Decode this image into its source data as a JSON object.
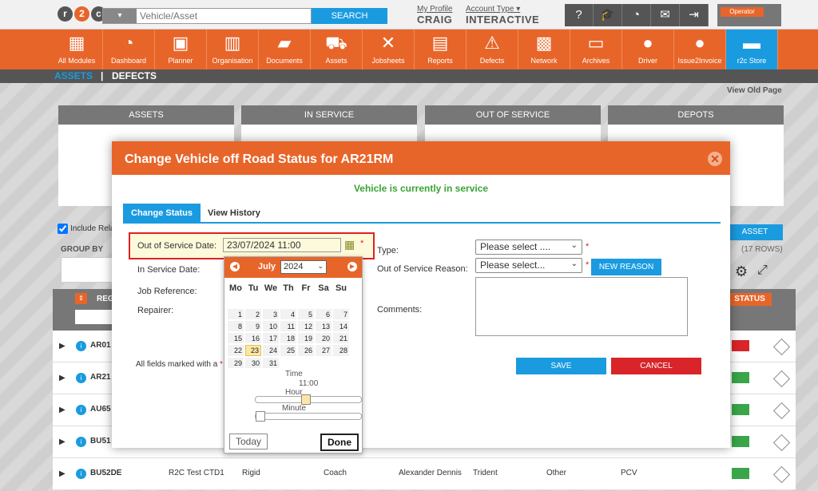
{
  "topbar": {
    "search_type_icon": "truck-icon",
    "search_placeholder": "Vehicle/Asset",
    "search_button": "SEARCH",
    "my_profile": "My Profile",
    "user_name": "CRAIG",
    "account_type_label": "Account Type",
    "account_type_value": "INTERACTIVE",
    "operator_label": "Operator"
  },
  "nav": {
    "items": [
      {
        "label": "All Modules",
        "icon": "grid-icon"
      },
      {
        "label": "Dashboard",
        "icon": "gauge-icon"
      },
      {
        "label": "Planner",
        "icon": "calendar-icon"
      },
      {
        "label": "Organisation",
        "icon": "building-icon"
      },
      {
        "label": "Documents",
        "icon": "folder-icon"
      },
      {
        "label": "Assets",
        "icon": "truck-icon"
      },
      {
        "label": "Jobsheets",
        "icon": "tools-icon"
      },
      {
        "label": "Reports",
        "icon": "clipboard-icon"
      },
      {
        "label": "Defects",
        "icon": "warning-icon"
      },
      {
        "label": "Network",
        "icon": "contact-icon"
      },
      {
        "label": "Archives",
        "icon": "archive-icon"
      },
      {
        "label": "Driver",
        "icon": "driver-icon"
      },
      {
        "label": "Issue2Invoice",
        "icon": "i2i-icon"
      },
      {
        "label": "r2c Store",
        "icon": "briefcase-icon"
      }
    ]
  },
  "subnav": {
    "assets": "ASSETS",
    "sep": "|",
    "defects": "DEFECTS"
  },
  "page": {
    "view_old": "View Old Page",
    "panels": [
      "ASSETS",
      "IN SERVICE",
      "OUT OF SERVICE",
      "DEPOTS"
    ],
    "include_label": "Include Rela",
    "group_by": "GROUP BY",
    "add_asset": "ASSET",
    "rows_count": "(17 ROWS)",
    "col_reg": "REG",
    "col_status": "STATUS",
    "rows": [
      {
        "reg": "AR01",
        "status_color": "red"
      },
      {
        "reg": "AR21",
        "status_color": "green"
      },
      {
        "reg": "AU65",
        "status_color": "green"
      },
      {
        "reg": "BU51",
        "status_color": "green"
      },
      {
        "reg": "BU52DE",
        "depot": "R2C Test CTD1",
        "body": "Rigid",
        "type": "Coach",
        "make": "Alexander Dennis",
        "model": "Trident",
        "category": "Other",
        "class": "PCV",
        "status_color": "green"
      }
    ]
  },
  "modal": {
    "title": "Change Vehicle off Road Status for AR21RM",
    "status_message": "Vehicle is currently in service",
    "tabs": [
      "Change Status",
      "View History"
    ],
    "out_of_service_label": "Out of Service Date:",
    "out_of_service_value": "23/07/2024 11:00",
    "in_service_label": "In Service Date:",
    "job_reference_label": "Job Reference:",
    "repairer_label": "Repairer:",
    "required_note": "All fields marked with a",
    "type_label": "Type:",
    "type_placeholder": "Please select ....",
    "reason_label": "Out of Service Reason:",
    "reason_placeholder": "Please select...",
    "new_reason": "NEW REASON",
    "comments_label": "Comments:",
    "save": "SAVE",
    "cancel": "CANCEL"
  },
  "datepicker": {
    "month": "July",
    "year": "2024",
    "weekdays": [
      "Mo",
      "Tu",
      "We",
      "Th",
      "Fr",
      "Sa",
      "Su"
    ],
    "weeks": [
      [
        "",
        "",
        "",
        "",
        "",
        "",
        ""
      ],
      [
        "1",
        "2",
        "3",
        "4",
        "5",
        "6",
        "7"
      ],
      [
        "8",
        "9",
        "10",
        "11",
        "12",
        "13",
        "14"
      ],
      [
        "15",
        "16",
        "17",
        "18",
        "19",
        "20",
        "21"
      ],
      [
        "22",
        "23",
        "24",
        "25",
        "26",
        "27",
        "28"
      ],
      [
        "29",
        "30",
        "31",
        "",
        "",
        "",
        ""
      ]
    ],
    "selected_day": "23",
    "time_label": "Time",
    "time_value": "11:00",
    "hour_label": "Hour",
    "hour_value": 11,
    "minute_label": "Minute",
    "minute_value": 0,
    "today_btn": "Today",
    "done_btn": "Done"
  }
}
